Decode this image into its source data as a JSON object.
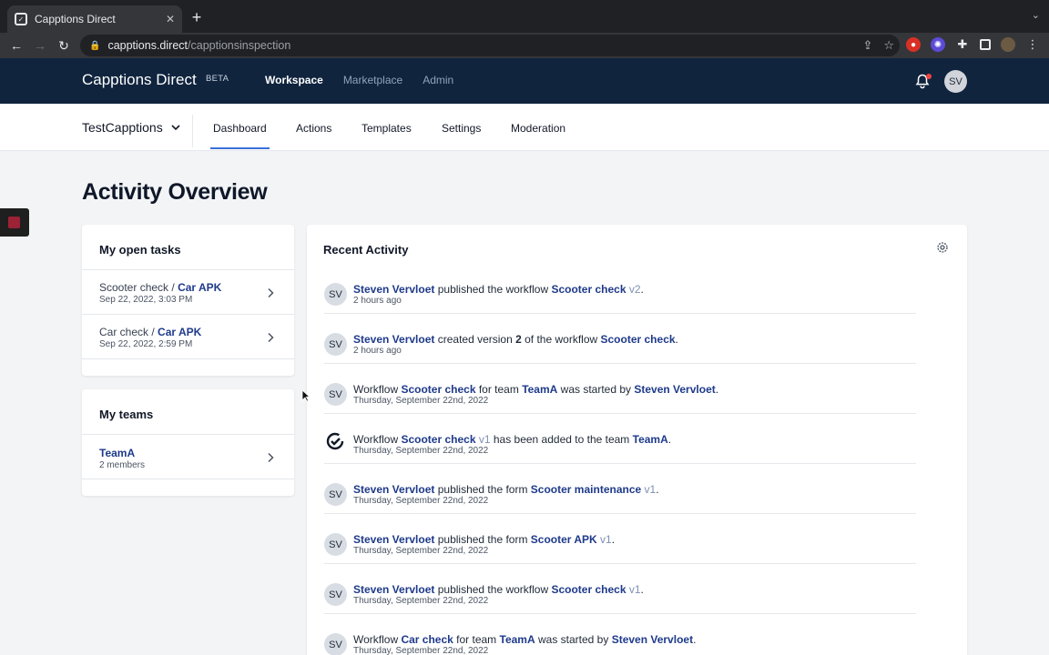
{
  "browser": {
    "tab_title": "Capptions Direct",
    "url_host": "capptions.direct",
    "url_path": "/capptionsinspection"
  },
  "app": {
    "brand": "Capptions Direct",
    "beta": "BETA",
    "nav": [
      {
        "label": "Workspace",
        "active": true
      },
      {
        "label": "Marketplace",
        "active": false
      },
      {
        "label": "Admin",
        "active": false
      }
    ],
    "user_initials": "SV"
  },
  "subnav": {
    "workspace": "TestCapptions",
    "tabs": [
      {
        "label": "Dashboard",
        "active": true
      },
      {
        "label": "Actions"
      },
      {
        "label": "Templates"
      },
      {
        "label": "Settings"
      },
      {
        "label": "Moderation"
      }
    ]
  },
  "page": {
    "title": "Activity Overview"
  },
  "open_tasks": {
    "title": "My open tasks",
    "items": [
      {
        "name": "Scooter check",
        "sep": " / ",
        "link": "Car APK",
        "date": "Sep 22, 2022, 3:03 PM"
      },
      {
        "name": "Car check",
        "sep": " / ",
        "link": "Car APK",
        "date": "Sep 22, 2022, 2:59 PM"
      }
    ]
  },
  "teams": {
    "title": "My teams",
    "items": [
      {
        "name": "TeamA",
        "members": "2 members"
      }
    ]
  },
  "activity": {
    "title": "Recent Activity",
    "items": [
      {
        "avatar": "SV",
        "parts": [
          [
            "lnk",
            "Steven Vervloet"
          ],
          [
            "txt",
            " published the workflow "
          ],
          [
            "lnk",
            "Scooter check"
          ],
          [
            "ver",
            " v2"
          ],
          [
            "txt",
            "."
          ]
        ],
        "time": "2 hours ago"
      },
      {
        "avatar": "SV",
        "parts": [
          [
            "lnk",
            "Steven Vervloet"
          ],
          [
            "txt",
            " created version "
          ],
          [
            "b",
            "2"
          ],
          [
            "txt",
            " of the workflow "
          ],
          [
            "lnk",
            "Scooter check"
          ],
          [
            "txt",
            "."
          ]
        ],
        "time": "2 hours ago"
      },
      {
        "avatar": "SV",
        "parts": [
          [
            "txt",
            "Workflow "
          ],
          [
            "lnk",
            "Scooter check"
          ],
          [
            "txt",
            " for team "
          ],
          [
            "lnk",
            "TeamA"
          ],
          [
            "txt",
            " was started by "
          ],
          [
            "lnk",
            "Steven Vervloet"
          ],
          [
            "txt",
            "."
          ]
        ],
        "time": "Thursday, September 22nd, 2022"
      },
      {
        "avatar": "",
        "logo": true,
        "parts": [
          [
            "txt",
            "Workflow "
          ],
          [
            "lnk",
            "Scooter check"
          ],
          [
            "ver",
            " v1"
          ],
          [
            "txt",
            " has been added to the team "
          ],
          [
            "lnk",
            "TeamA"
          ],
          [
            "txt",
            "."
          ]
        ],
        "time": "Thursday, September 22nd, 2022"
      },
      {
        "avatar": "SV",
        "parts": [
          [
            "lnk",
            "Steven Vervloet"
          ],
          [
            "txt",
            " published the form "
          ],
          [
            "lnk",
            "Scooter maintenance"
          ],
          [
            "ver",
            " v1"
          ],
          [
            "txt",
            "."
          ]
        ],
        "time": "Thursday, September 22nd, 2022"
      },
      {
        "avatar": "SV",
        "parts": [
          [
            "lnk",
            "Steven Vervloet"
          ],
          [
            "txt",
            " published the form "
          ],
          [
            "lnk",
            "Scooter APK"
          ],
          [
            "ver",
            " v1"
          ],
          [
            "txt",
            "."
          ]
        ],
        "time": "Thursday, September 22nd, 2022"
      },
      {
        "avatar": "SV",
        "parts": [
          [
            "lnk",
            "Steven Vervloet"
          ],
          [
            "txt",
            " published the workflow "
          ],
          [
            "lnk",
            "Scooter check"
          ],
          [
            "ver",
            " v1"
          ],
          [
            "txt",
            "."
          ]
        ],
        "time": "Thursday, September 22nd, 2022"
      },
      {
        "avatar": "SV",
        "parts": [
          [
            "txt",
            "Workflow "
          ],
          [
            "lnk",
            "Car check"
          ],
          [
            "txt",
            " for team "
          ],
          [
            "lnk",
            "TeamA"
          ],
          [
            "txt",
            " was started by "
          ],
          [
            "lnk",
            "Steven Vervloet"
          ],
          [
            "txt",
            "."
          ]
        ],
        "time": "Thursday, September 22nd, 2022"
      }
    ]
  },
  "colors": {
    "header_bg": "#10243e",
    "link": "#1e3a8a",
    "accent": "#3b6fd8",
    "notification": "#ef4444"
  }
}
